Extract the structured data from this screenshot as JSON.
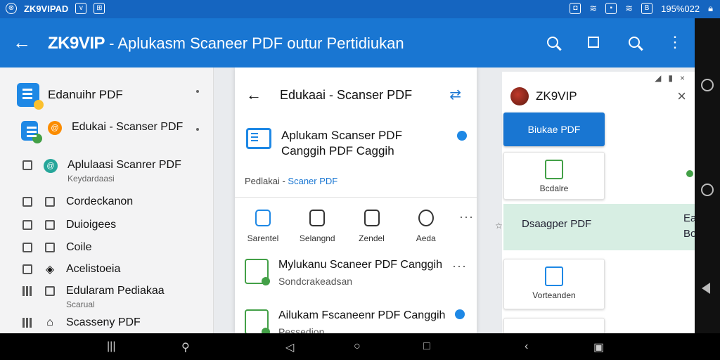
{
  "status_bar": {
    "left_text": "ZK9VIPAD",
    "right_text": "195%022",
    "icons": [
      "app-logo-icon",
      "v-badge-icon",
      "image-icon",
      "notification-icon",
      "wifi-icon",
      "image-icon",
      "wifi-icon",
      "battery-icon",
      "lock-icon"
    ]
  },
  "app_bar": {
    "brand": "ZK9VIP",
    "title": "- Aplukasm Scaneer PDF outur Pertidiukan",
    "actions": [
      "search-icon",
      "square-icon",
      "search-icon",
      "more-icon"
    ]
  },
  "drawer": {
    "header": "Edanuihr PDF",
    "items": [
      {
        "label": "Edukai - Scanser PDF",
        "sub": "",
        "icon": "pdf-badge-icon"
      },
      {
        "label": "Aplulaasi Scanrer PDF",
        "sub": "Keydardaasi",
        "icon": "teal-circle-icon"
      },
      {
        "label": "Cordeckanon",
        "sub": "",
        "icon": "document-icon"
      },
      {
        "label": "Duioigees",
        "sub": "",
        "icon": "file-icon"
      },
      {
        "label": "Coile",
        "sub": "",
        "icon": "image-icon"
      },
      {
        "label": "Acelistoeia",
        "sub": "",
        "icon": "shield-icon"
      },
      {
        "label": "Edularam Pediakaa",
        "sub": "Scarual",
        "icon": "checkbox-icon"
      },
      {
        "label": "Scasseny PDF",
        "sub": "",
        "icon": "home-icon"
      }
    ]
  },
  "sheet": {
    "title": "Edukaai - Scanser PDF",
    "main_item": "Aplukam Scanser PDF Canggih PDF Caggih",
    "crumb_prefix": "Pedlakai - ",
    "crumb_link": "Scaner PDF",
    "actions": [
      {
        "label": "Sarentel",
        "icon": "clipboard-icon"
      },
      {
        "label": "Selangnd",
        "icon": "print-icon"
      },
      {
        "label": "Zendel",
        "icon": "archive-icon"
      },
      {
        "label": "Aeda",
        "icon": "info-icon"
      }
    ],
    "files": [
      {
        "title": "Mylukanu Scaneer PDF Canggih",
        "subtitle": "Sondcrakeadsan"
      },
      {
        "title": "Ailukam Fscaneenr PDF Canggih",
        "subtitle": "Pessedion"
      }
    ]
  },
  "popup": {
    "title": "ZK9VIP",
    "primary_button": "Biukae PDF",
    "card1_label": "Bcdalre",
    "mint_label": "Dsaagper PDF",
    "mint_right_1": "Ea",
    "mint_right_2": "Bo",
    "card2_label": "Vorteanden"
  },
  "nav": [
    "recents-icon",
    "brush-icon",
    "back-icon",
    "home-icon",
    "overview-icon",
    "chevron-left-icon",
    "print-icon"
  ]
}
